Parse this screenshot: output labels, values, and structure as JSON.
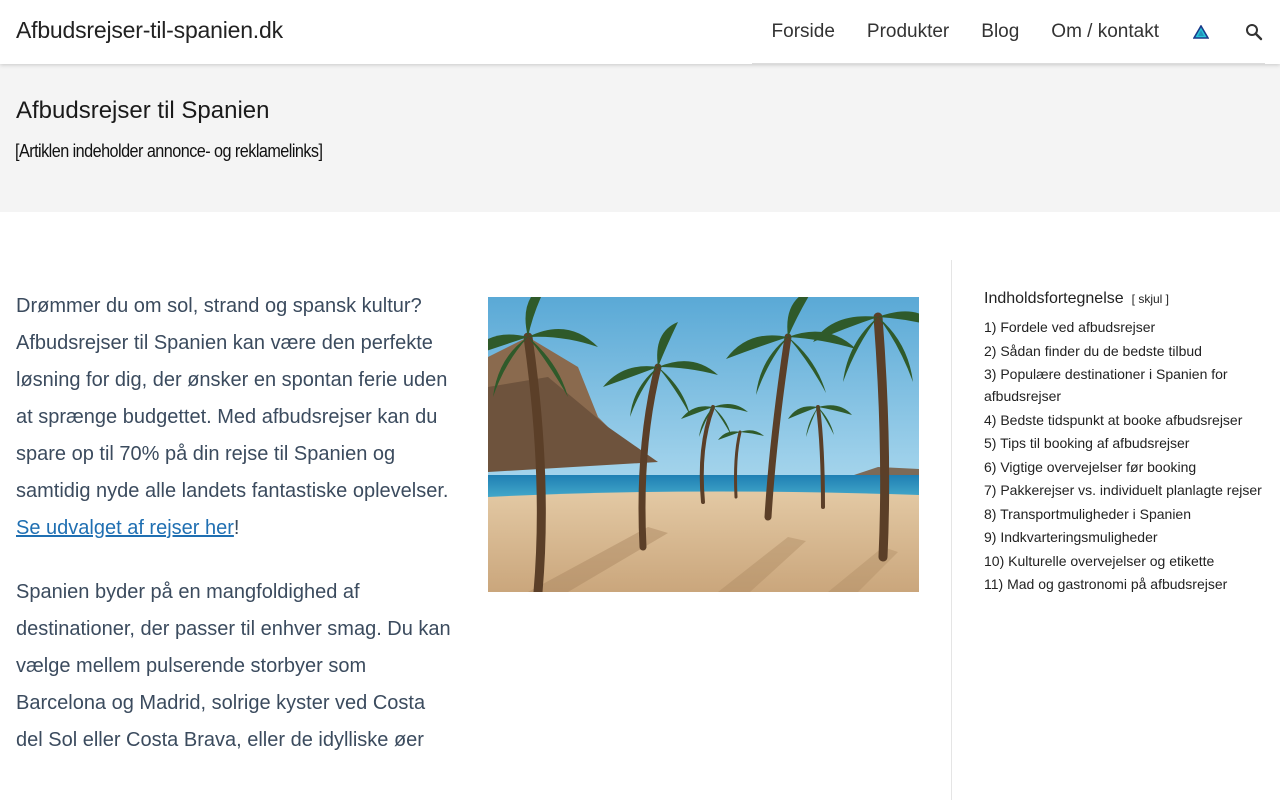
{
  "header": {
    "site_title": "Afbudsrejser-til-spanien.dk",
    "nav": [
      "Forside",
      "Produkter",
      "Blog",
      "Om / kontakt"
    ],
    "icons": [
      "triangle-logo-icon",
      "search-icon"
    ]
  },
  "hero": {
    "title": "Afbudsrejser til Spanien",
    "note": "[Artiklen indeholder annonce- og reklamelinks]"
  },
  "article": {
    "p1_text": "Drømmer du om sol, strand og spansk kultur? Afbudsrejser til Spanien kan være den perfekte løsning for dig, der ønsker en spontan ferie uden at sprænge budgettet. Med afbudsrejser kan du spare op til 70% på din rejse til Spanien og samtidig nyde alle landets fantastiske oplevelser. ",
    "p1_link": "Se udvalget af rejser her",
    "p1_end": "!",
    "p2_text": "Spanien byder på en mangfoldighed af destinationer, der passer til enhver smag. Du kan vælge mellem pulserende storbyer som Barcelona og Madrid, solrige kyster ved Costa del Sol eller Costa Brava, eller de idylliske øer"
  },
  "toc": {
    "title": "Indholdsfortegnelse",
    "toggle": "[ skjul ]",
    "items": [
      "1) Fordele ved afbudsrejser",
      "2) Sådan finder du de bedste tilbud",
      "3) Populære destinationer i Spanien for afbudsrejser",
      "4) Bedste tidspunkt at booke afbudsrejser",
      "5) Tips til booking af afbudsrejser",
      "6) Vigtige overvejelser før booking",
      "7) Pakkerejser vs. individuelt planlagte rejser",
      "8) Transportmuligheder i Spanien",
      "9) Indkvarteringsmuligheder",
      "10) Kulturelle overvejelser og etikette",
      "11) Mad og gastronomi på afbudsrejser"
    ]
  },
  "colors": {
    "accent": "#1f6fb2",
    "hero_bg": "#f4f4f4",
    "body_text": "#3b4b5e"
  }
}
